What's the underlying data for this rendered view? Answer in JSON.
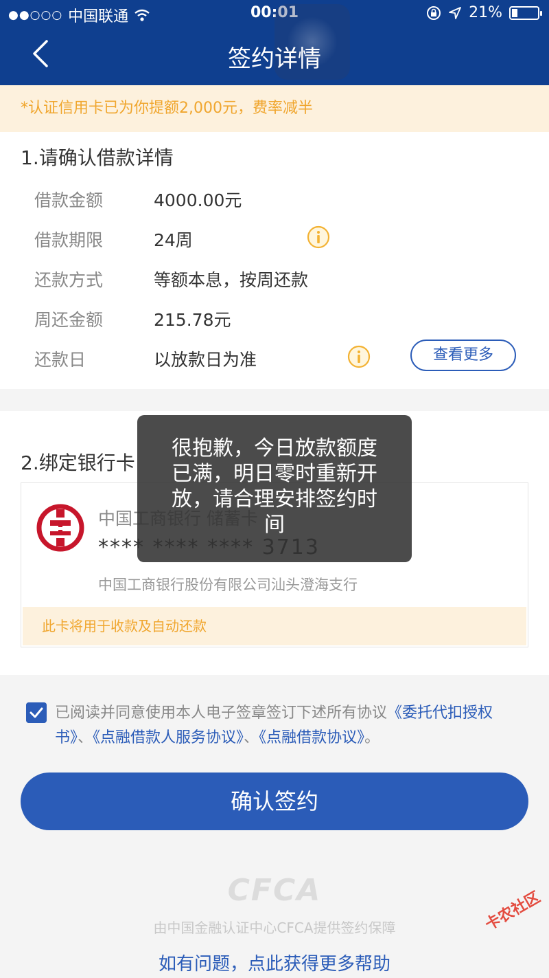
{
  "status_bar": {
    "signal_dots": "●●○○○",
    "carrier": "中国联通",
    "time": "00:01",
    "battery_percent": "21%",
    "battery_level": 0.21
  },
  "nav": {
    "title": "签约详情"
  },
  "notice": "*认证信用卡已为你提额2,000元，费率减半",
  "loan": {
    "section_title": "1.请确认借款详情",
    "rows": [
      {
        "label": "借款金额",
        "value": "4000.00元"
      },
      {
        "label": "借款期限",
        "value": "24周"
      },
      {
        "label": "还款方式",
        "value": "等额本息，按周还款"
      },
      {
        "label": "周还金额",
        "value": "215.78元"
      },
      {
        "label": "还款日",
        "value": "以放款日为准"
      }
    ],
    "more_button": "查看更多"
  },
  "bank": {
    "section_title": "2.绑定银行卡",
    "bank_name": "中国工商银行 储蓄卡",
    "card_number": "**** **** **** 3713",
    "branch": "中国工商银行股份有限公司汕头澄海支行",
    "note": "此卡将用于收款及自动还款"
  },
  "agreement": {
    "prefix": "已阅读并同意使用本人电子签章签订下述所有协议",
    "link1": "《委托代扣授权书》",
    "sep1": "、",
    "link2": "《点融借款人服务协议》",
    "sep2": "、",
    "link3": "《点融借款协议》",
    "suffix": "。"
  },
  "confirm_button": "确认签约",
  "footer": {
    "logo": "CFCA",
    "guarantee": "由中国金融认证中心CFCA提供签约保障",
    "help": "如有问题，点此获得更多帮助"
  },
  "toast": "很抱歉，今日放款额度已满，明日零时重新开放，请合理安排签约时间",
  "watermark": "卡农社区",
  "colors": {
    "header": "#0f3f8f",
    "accent": "#2b5cb8",
    "notice_text": "#f0a62e",
    "notice_bg": "#fdf1dd"
  }
}
